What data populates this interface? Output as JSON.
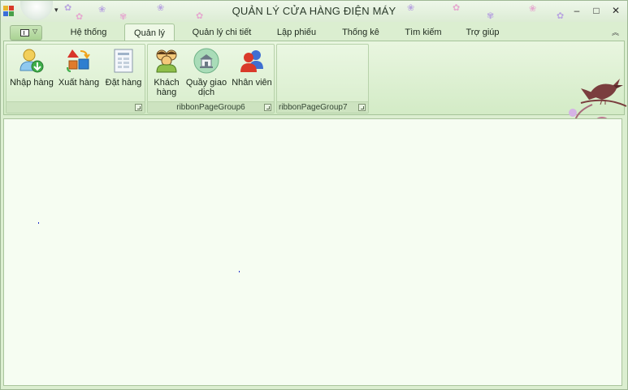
{
  "window": {
    "title": "QUẢN LÝ CỬA HÀNG ĐIỆN MÁY",
    "controls": {
      "minimize": "–",
      "maximize": "□",
      "close": "✕"
    }
  },
  "tabs": [
    {
      "label": "Hệ thống",
      "active": false
    },
    {
      "label": "Quản lý",
      "active": true
    },
    {
      "label": "Quản lý chi tiết",
      "active": false
    },
    {
      "label": "Lập phiếu",
      "active": false
    },
    {
      "label": "Thống kê",
      "active": false
    },
    {
      "label": "Tìm kiếm",
      "active": false
    },
    {
      "label": "Trợ giúp",
      "active": false
    }
  ],
  "ribbon": {
    "groups": [
      {
        "caption": "",
        "buttons": [
          {
            "label": "Nhập hàng",
            "icon": "import-goods-icon"
          },
          {
            "label": "Xuất hàng",
            "icon": "export-goods-icon"
          },
          {
            "label": "Đặt hàng",
            "icon": "order-form-icon"
          }
        ]
      },
      {
        "caption": "ribbonPageGroup6",
        "buttons": [
          {
            "label": "Khách hàng",
            "icon": "customers-icon"
          },
          {
            "label": "Quầy giao dịch",
            "icon": "counter-icon"
          },
          {
            "label": "Nhân viên",
            "icon": "employees-icon"
          }
        ]
      },
      {
        "caption": "ribbonPageGroup7",
        "buttons": []
      }
    ]
  },
  "colors": {
    "ribbon_bg": "#dbeed0",
    "content_bg": "#f6fdf2",
    "accent": "#a9d293"
  }
}
